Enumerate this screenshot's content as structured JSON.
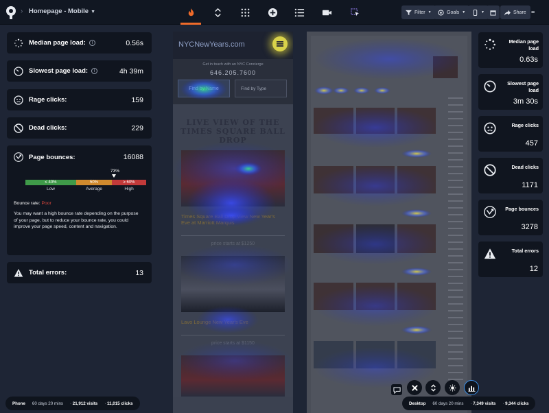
{
  "header": {
    "breadcrumb": "Homepage - Mobile",
    "filter_label": "Filter",
    "goals_label": "Goals",
    "share_label": "Share",
    "more_label": "•••"
  },
  "left_metrics": {
    "median_load": {
      "label": "Median page load:",
      "value": "0.56s"
    },
    "slowest_load": {
      "label": "Slowest page load:",
      "value": "4h 39m"
    },
    "rage_clicks": {
      "label": "Rage clicks:",
      "value": "159"
    },
    "dead_clicks": {
      "label": "Dead clicks:",
      "value": "229"
    },
    "page_bounces": {
      "label": "Page bounces:",
      "value": "16088",
      "gauge_value": "73%",
      "segments": [
        "≤ 40%",
        "50%",
        "≥ 60%"
      ],
      "segment_labels": [
        "Low",
        "Average",
        "High"
      ],
      "rate_label": "Bounce rate:",
      "rate_value": "Poor",
      "description": "You may want a high bounce rate depending on the purpose of your page, but to reduce your bounce rate, you could improve your page speed, content and navigation."
    },
    "total_errors": {
      "label": "Total errors:",
      "value": "13"
    }
  },
  "right_metrics": [
    {
      "label": "Median page load",
      "value": "0.63s"
    },
    {
      "label": "Slowest page load",
      "value": "3m 30s"
    },
    {
      "label": "Rage clicks",
      "value": "457"
    },
    {
      "label": "Dead clicks",
      "value": "1171"
    },
    {
      "label": "Page bounces",
      "value": "3278"
    },
    {
      "label": "Total errors",
      "value": "12"
    }
  ],
  "mobile_preview": {
    "logo": "NYCNewYears.com",
    "tagline": "Get in touch with an NYC Concierge",
    "phone": "646.205.7600",
    "select_1": "Find by Name",
    "select_2": "Find by Type",
    "headline": "LIVE VIEW OF THE TIMES SQUARE BALL DROP",
    "event_1_title": "Times Square Ball Drop View New Year's Eve at Marriott Marquis",
    "event_1_price": "price starts at $1250",
    "event_2_title": "Lavo Lounge New Year's Eve",
    "event_2_price": "price starts at $1150"
  },
  "bottom": {
    "phone": {
      "device": "Phone",
      "range": "60 days 20 mins",
      "visits": "21,912 visits",
      "clicks": "11,015 clicks"
    },
    "desktop": {
      "device": "Desktop",
      "range": "60 days 20 mins",
      "visits": "7,349 visits",
      "clicks": "9,344 clicks"
    }
  }
}
